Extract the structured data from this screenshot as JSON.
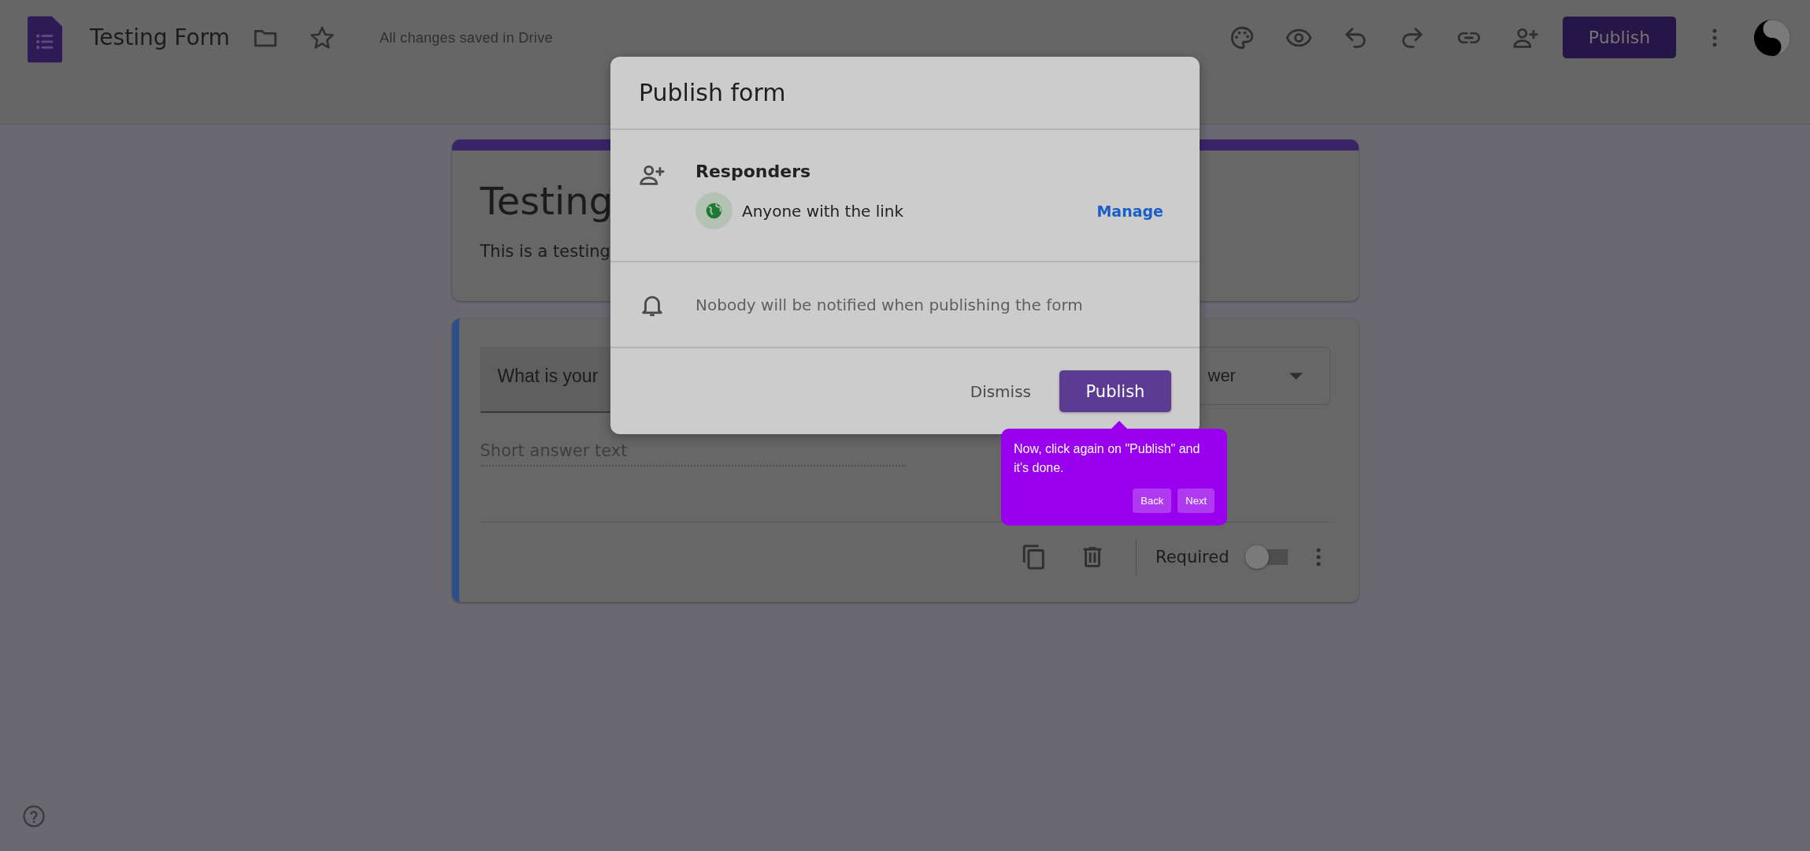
{
  "top_bar": {
    "title": "Testing Form",
    "save_status": "All changes saved in Drive",
    "publish_button": "Publish"
  },
  "form": {
    "title": "Testing",
    "description": "This is a testing",
    "question": {
      "title": "What is your",
      "type": "wer",
      "placeholder": "Short answer text",
      "required_label": "Required",
      "required": false
    }
  },
  "dialog": {
    "title": "Publish form",
    "responders": {
      "heading": "Responders",
      "access": "Anyone with the link",
      "manage": "Manage"
    },
    "notification": "Nobody will be notified when publishing the form",
    "buttons": [
      {
        "label": "Dismiss",
        "kind": "text"
      },
      {
        "label": "Publish",
        "kind": "filled"
      }
    ]
  },
  "tour_tip": {
    "text": "Now, click again on \"Publish\" and it's done.",
    "buttons": [
      {
        "label": "Back"
      },
      {
        "label": "Next"
      }
    ]
  }
}
